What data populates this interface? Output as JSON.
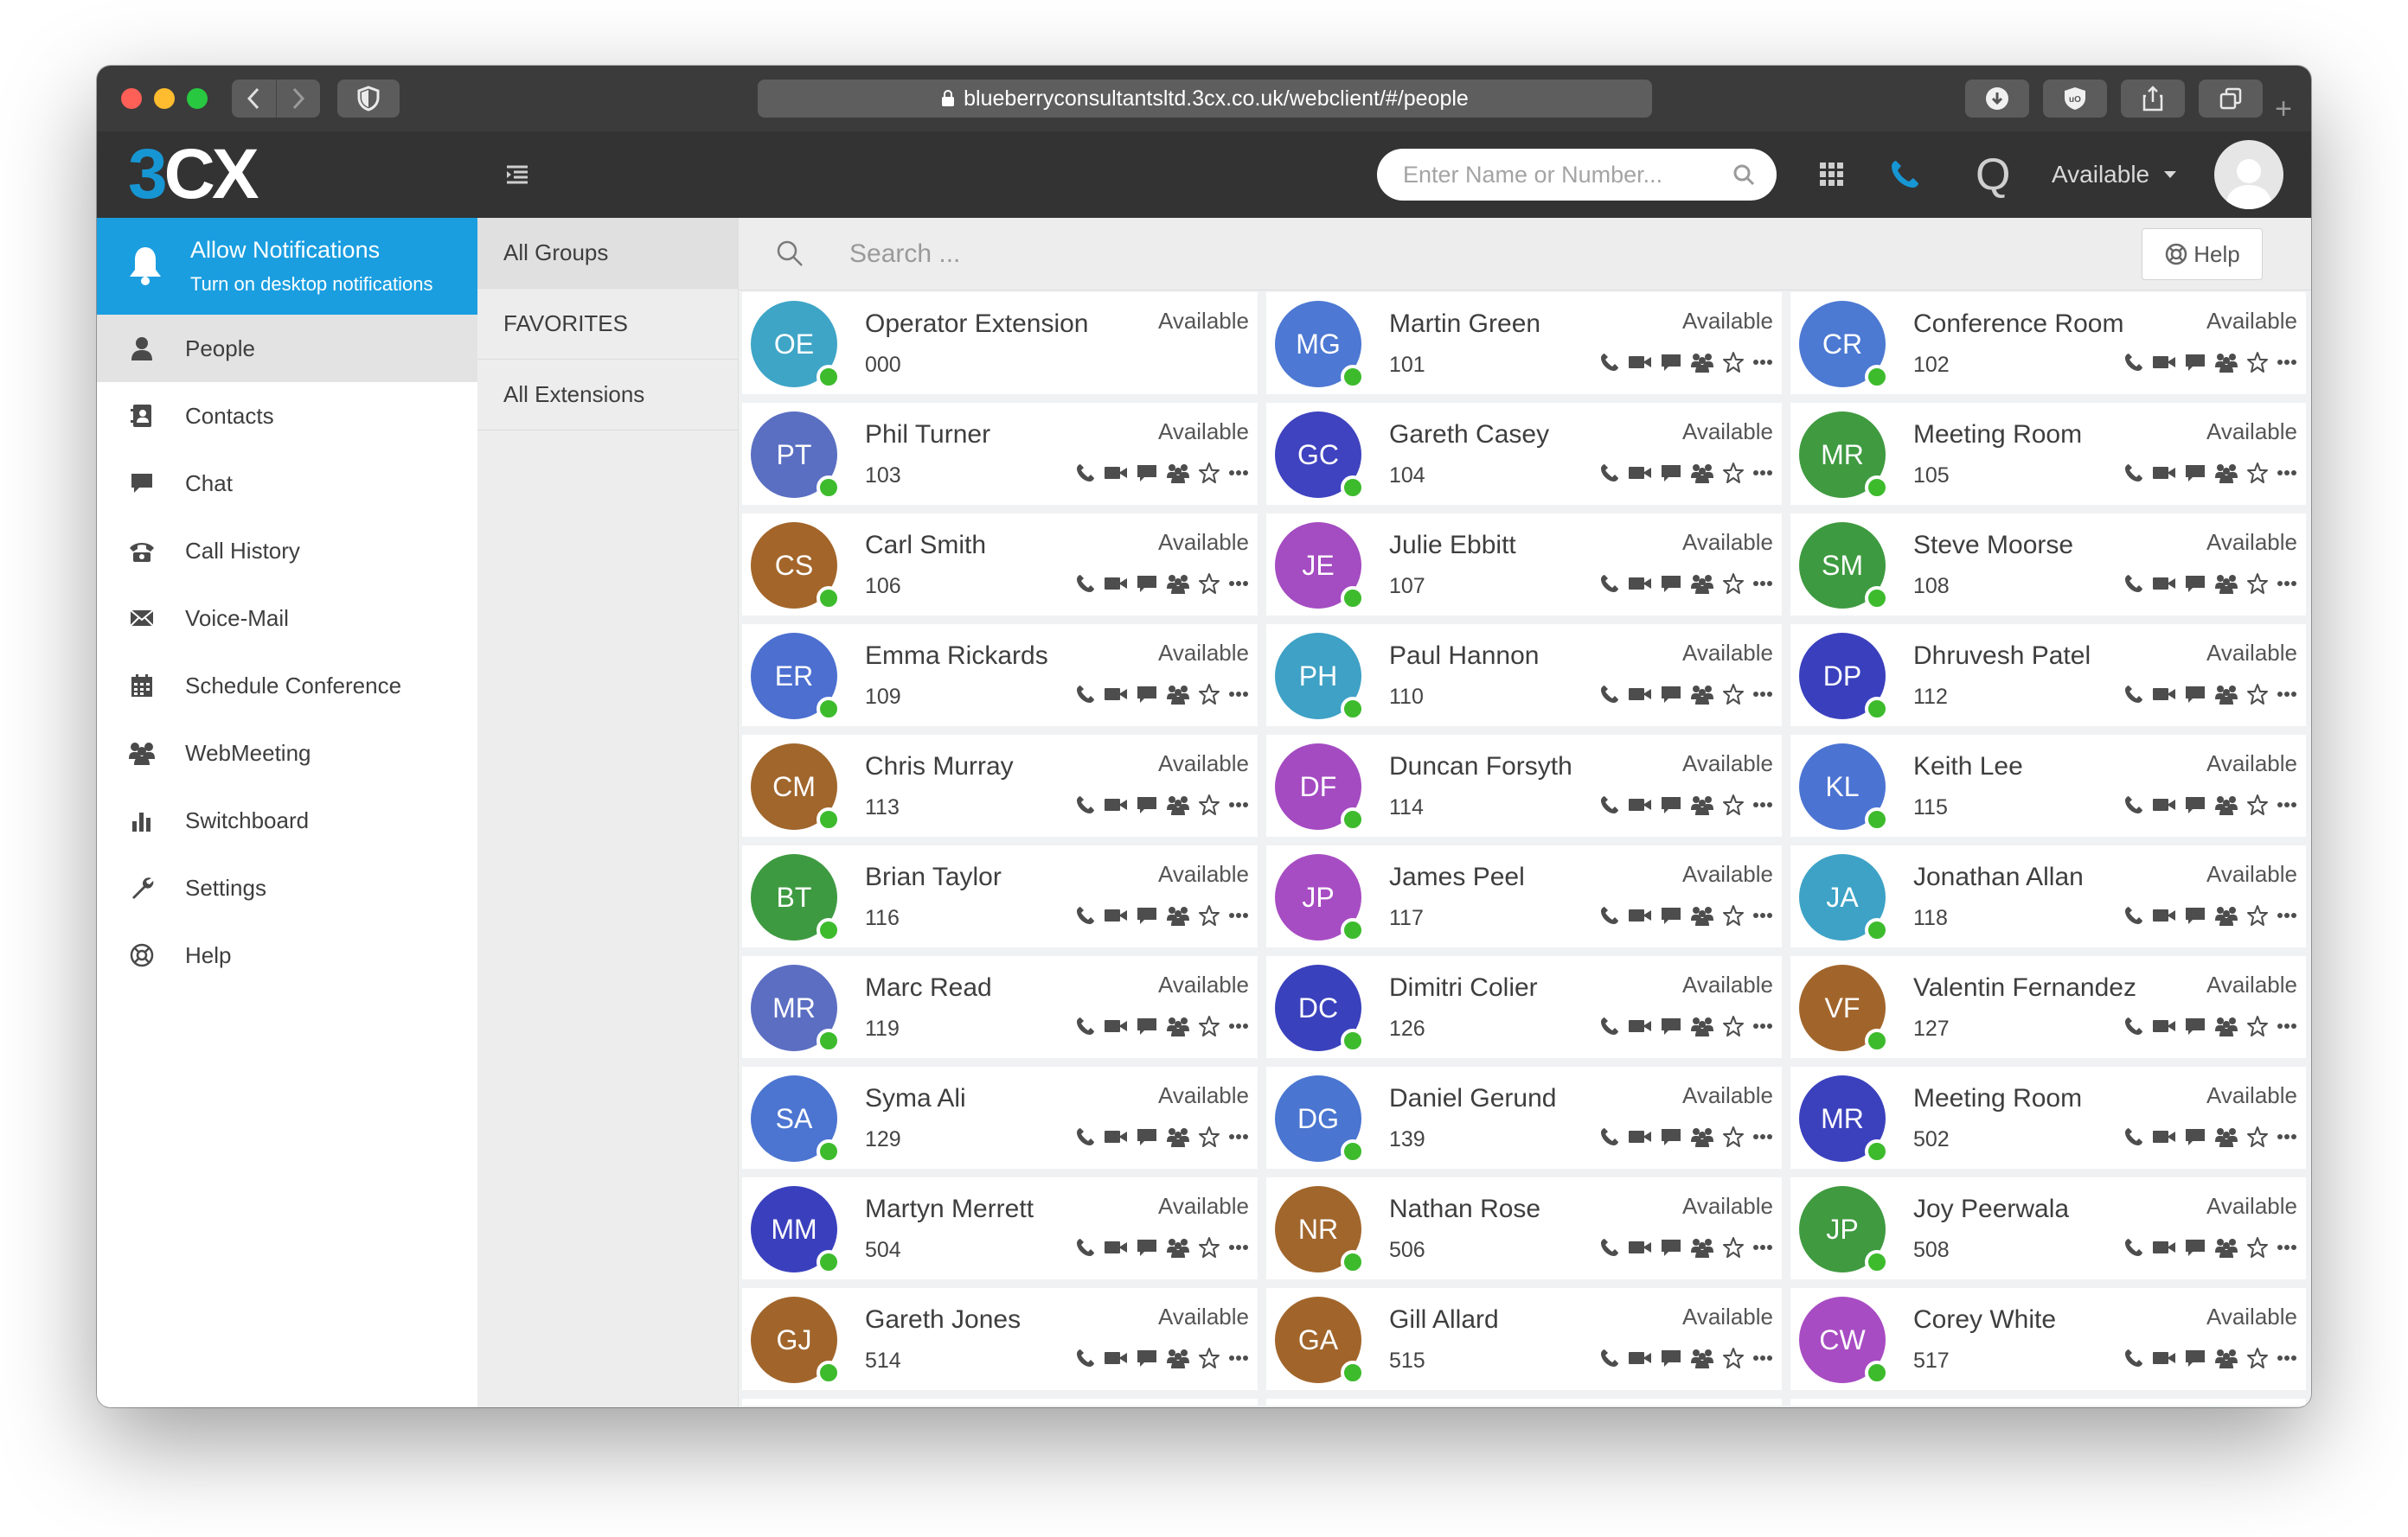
{
  "browser": {
    "url": "blueberryconsultantsltd.3cx.co.uk/webclient/#/people"
  },
  "app": {
    "logo_accent": "3",
    "logo_rest": "CX",
    "search_placeholder": "Enter Name or Number...",
    "q_label": "Q",
    "status_label": "Available"
  },
  "notification": {
    "title": "Allow Notifications",
    "subtitle": "Turn on desktop notifications"
  },
  "nav": [
    {
      "label": "People",
      "icon": "person-icon",
      "active": true
    },
    {
      "label": "Contacts",
      "icon": "address-book-icon"
    },
    {
      "label": "Chat",
      "icon": "chat-icon"
    },
    {
      "label": "Call History",
      "icon": "call-history-icon"
    },
    {
      "label": "Voice-Mail",
      "icon": "voicemail-icon"
    },
    {
      "label": "Schedule Conference",
      "icon": "calendar-icon"
    },
    {
      "label": "WebMeeting",
      "icon": "group-icon"
    },
    {
      "label": "Switchboard",
      "icon": "bar-chart-icon"
    },
    {
      "label": "Settings",
      "icon": "wrench-icon"
    },
    {
      "label": "Help",
      "icon": "lifebuoy-icon"
    }
  ],
  "groups": [
    "All Groups",
    "FAVORITES",
    "All Extensions"
  ],
  "main": {
    "search_placeholder": "Search ...",
    "help_label": "Help"
  },
  "colors": {
    "accent": "#1a9ee0",
    "online": "#3dbb2d"
  },
  "people": [
    {
      "initials": "OE",
      "name": "Operator Extension",
      "ext": "000",
      "status": "Available",
      "color": "#3ea5c7",
      "noActions": true
    },
    {
      "initials": "MG",
      "name": "Martin Green",
      "ext": "101",
      "status": "Available",
      "color": "#4d78d3"
    },
    {
      "initials": "CR",
      "name": "Conference Room",
      "ext": "102",
      "status": "Available",
      "color": "#4c79d2"
    },
    {
      "initials": "PT",
      "name": "Phil Turner",
      "ext": "103",
      "status": "Available",
      "color": "#5a6fc2"
    },
    {
      "initials": "GC",
      "name": "Gareth Casey",
      "ext": "104",
      "status": "Available",
      "color": "#3f43bf"
    },
    {
      "initials": "MR",
      "name": "Meeting Room",
      "ext": "105",
      "status": "Available",
      "color": "#3f9a40"
    },
    {
      "initials": "CS",
      "name": "Carl Smith",
      "ext": "106",
      "status": "Available",
      "color": "#a3652a"
    },
    {
      "initials": "JE",
      "name": "Julie Ebbitt",
      "ext": "107",
      "status": "Available",
      "color": "#a44cc1"
    },
    {
      "initials": "SM",
      "name": "Steve Moorse",
      "ext": "108",
      "status": "Available",
      "color": "#3e9a40"
    },
    {
      "initials": "ER",
      "name": "Emma Rickards",
      "ext": "109",
      "status": "Available",
      "color": "#4c6fd0"
    },
    {
      "initials": "PH",
      "name": "Paul Hannon",
      "ext": "110",
      "status": "Available",
      "color": "#3ea1c5"
    },
    {
      "initials": "DP",
      "name": "Dhruvesh Patel",
      "ext": "112",
      "status": "Available",
      "color": "#3a40bd"
    },
    {
      "initials": "CM",
      "name": "Chris Murray",
      "ext": "113",
      "status": "Available",
      "color": "#a0662c"
    },
    {
      "initials": "DF",
      "name": "Duncan Forsyth",
      "ext": "114",
      "status": "Available",
      "color": "#a44bc2"
    },
    {
      "initials": "KL",
      "name": "Keith Lee",
      "ext": "115",
      "status": "Available",
      "color": "#4b73d2"
    },
    {
      "initials": "BT",
      "name": "Brian Taylor",
      "ext": "116",
      "status": "Available",
      "color": "#3e9a41"
    },
    {
      "initials": "JP",
      "name": "James Peel",
      "ext": "117",
      "status": "Available",
      "color": "#a74dc3"
    },
    {
      "initials": "JA",
      "name": "Jonathan Allan",
      "ext": "118",
      "status": "Available",
      "color": "#3da2c6"
    },
    {
      "initials": "MR",
      "name": "Marc Read",
      "ext": "119",
      "status": "Available",
      "color": "#5b6ec2"
    },
    {
      "initials": "DC",
      "name": "Dimitri Colier",
      "ext": "126",
      "status": "Available",
      "color": "#3a41bd"
    },
    {
      "initials": "VF",
      "name": "Valentin Fernandez",
      "ext": "127",
      "status": "Available",
      "color": "#a1652b"
    },
    {
      "initials": "SA",
      "name": "Syma Ali",
      "ext": "129",
      "status": "Available",
      "color": "#4c75d1"
    },
    {
      "initials": "DG",
      "name": "Daniel Gerund",
      "ext": "139",
      "status": "Available",
      "color": "#4a75d0"
    },
    {
      "initials": "MR",
      "name": "Meeting Room",
      "ext": "502",
      "status": "Available",
      "color": "#3b41bd"
    },
    {
      "initials": "MM",
      "name": "Martyn Merrett",
      "ext": "504",
      "status": "Available",
      "color": "#3a40bd"
    },
    {
      "initials": "NR",
      "name": "Nathan Rose",
      "ext": "506",
      "status": "Available",
      "color": "#a1662c"
    },
    {
      "initials": "JP",
      "name": "Joy Peerwala",
      "ext": "508",
      "status": "Available",
      "color": "#3f9a40"
    },
    {
      "initials": "GJ",
      "name": "Gareth Jones",
      "ext": "514",
      "status": "Available",
      "color": "#a1652b"
    },
    {
      "initials": "GA",
      "name": "Gill Allard",
      "ext": "515",
      "status": "Available",
      "color": "#a1652b"
    },
    {
      "initials": "CW",
      "name": "Corey White",
      "ext": "517",
      "status": "Available",
      "color": "#a84cc3"
    }
  ]
}
